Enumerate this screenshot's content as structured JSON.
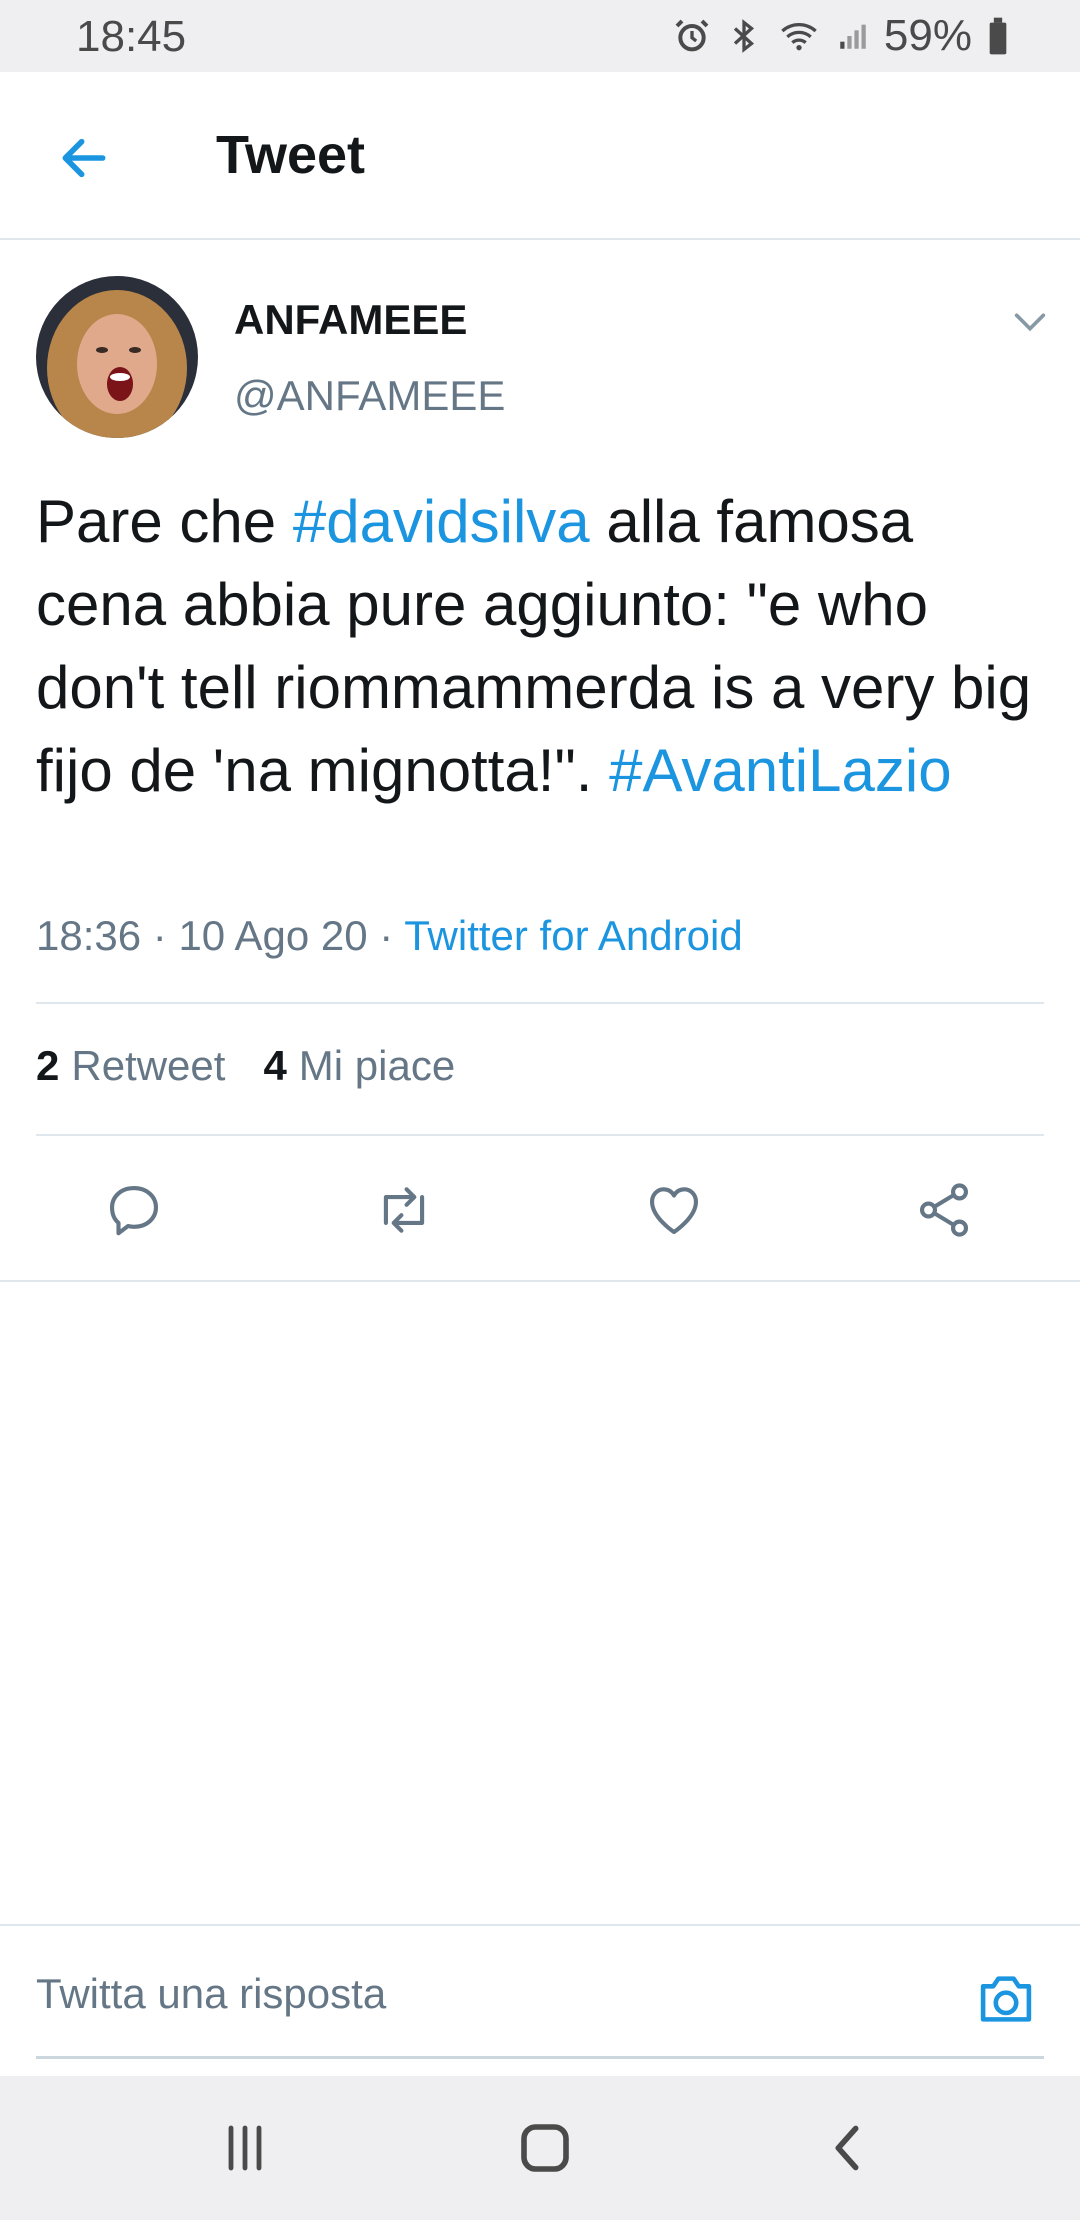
{
  "status_bar": {
    "time": "18:45",
    "battery": "59%",
    "icons": [
      "alarm-icon",
      "bluetooth-icon",
      "wifi-icon",
      "signal-icon",
      "battery-icon"
    ]
  },
  "header": {
    "title": "Tweet",
    "back_icon": "arrow-left-icon"
  },
  "tweet": {
    "display_name": "ANFAMEEE",
    "handle": "@ANFAMEEE",
    "text_segments": {
      "t1": "Pare che ",
      "hashtag1": "#davidsilva",
      "t2": " alla famosa cena abbia pure aggiunto: \"e who don't tell riommammerda is a very big fijo de 'na mignotta!\". ",
      "hashtag2": "#AvantiLazio"
    },
    "meta": {
      "time": "18:36",
      "date": "10 Ago 20",
      "separator": " · ",
      "source": "Twitter for Android"
    },
    "stats": {
      "retweet_count": "2",
      "retweet_label": "Retweet",
      "like_count": "4",
      "like_label": "Mi piace"
    }
  },
  "actions": [
    "reply-icon",
    "retweet-icon",
    "like-icon",
    "share-icon"
  ],
  "reply_bar": {
    "placeholder": "Twitta una risposta"
  },
  "colors": {
    "accent": "#1b95e0",
    "text": "#14171a",
    "secondary": "#657786",
    "divider": "#e1e8ed",
    "system_bar": "#efeff1"
  }
}
